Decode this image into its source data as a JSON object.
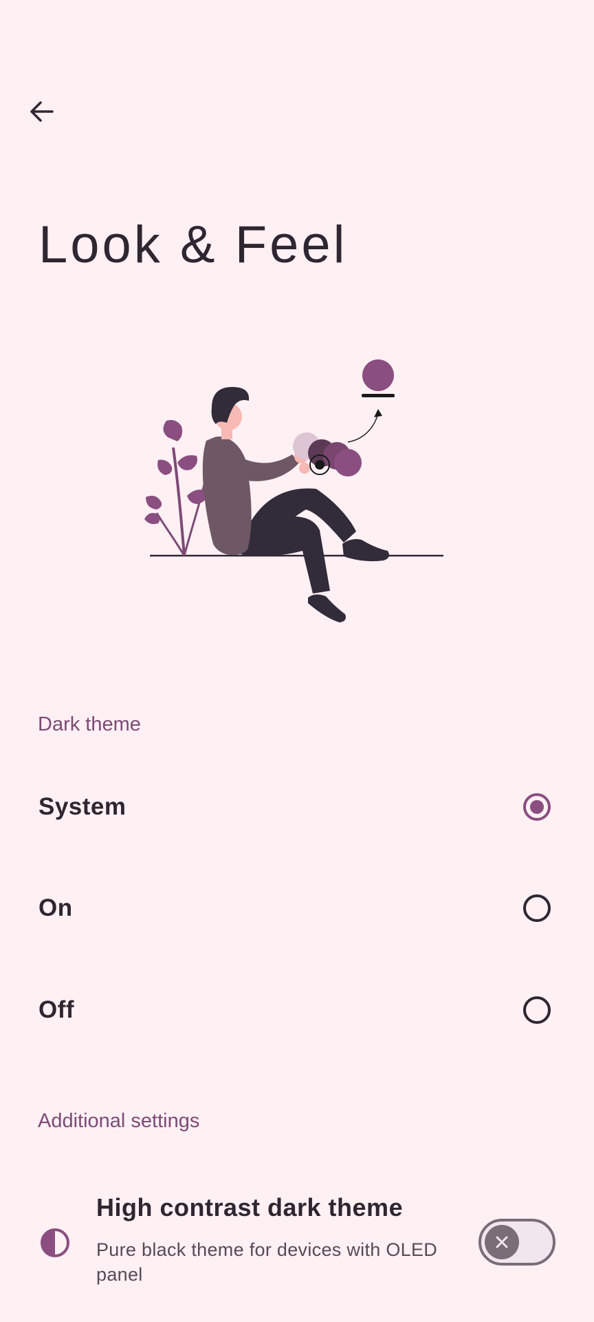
{
  "header": {
    "back_icon": "arrow-back-icon",
    "title": "Look & Feel"
  },
  "illustration": {
    "name": "person-sitting-color-picker-illustration"
  },
  "dark_theme": {
    "section_label": "Dark theme",
    "options": [
      {
        "label": "System",
        "selected": true
      },
      {
        "label": "On",
        "selected": false
      },
      {
        "label": "Off",
        "selected": false
      }
    ]
  },
  "additional": {
    "section_label": "Additional settings",
    "high_contrast": {
      "icon": "contrast-icon",
      "title": "High contrast dark theme",
      "subtitle": "Pure black theme for devices with OLED panel",
      "enabled": false
    }
  },
  "colors": {
    "background": "#fff0f4",
    "accent": "#8a4e80",
    "section_header": "#7c4a76",
    "text": "#2e2630"
  }
}
